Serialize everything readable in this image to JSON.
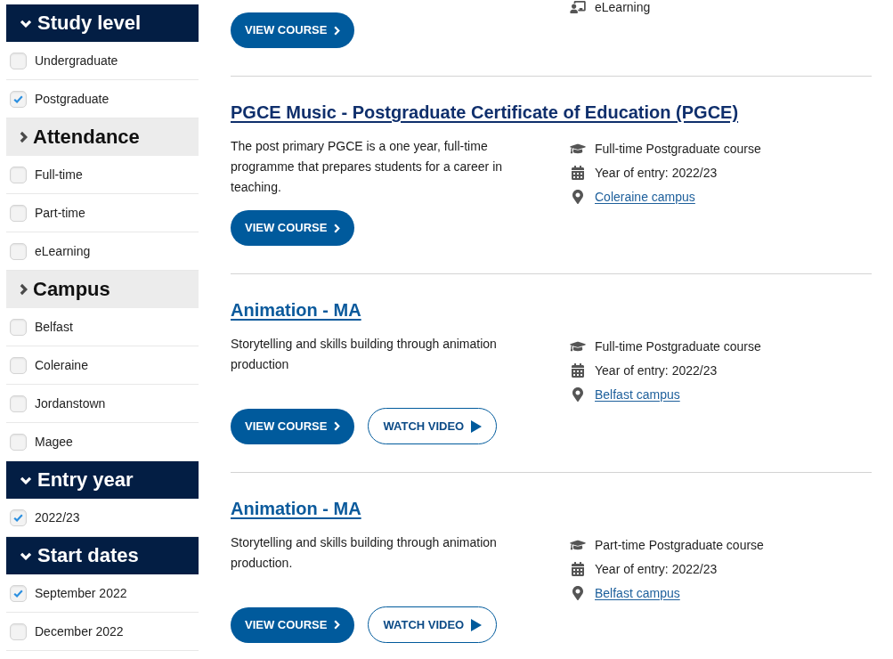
{
  "filters": [
    {
      "title": "Study level",
      "expanded": true,
      "options": [
        {
          "label": "Undergraduate",
          "checked": false
        },
        {
          "label": "Postgraduate",
          "checked": true
        }
      ]
    },
    {
      "title": "Attendance",
      "expanded": false,
      "options": [
        {
          "label": "Full-time",
          "checked": false
        },
        {
          "label": "Part-time",
          "checked": false
        },
        {
          "label": "eLearning",
          "checked": false
        }
      ]
    },
    {
      "title": "Campus",
      "expanded": false,
      "options": [
        {
          "label": "Belfast",
          "checked": false
        },
        {
          "label": "Coleraine",
          "checked": false
        },
        {
          "label": "Jordanstown",
          "checked": false
        },
        {
          "label": "Magee",
          "checked": false
        }
      ]
    },
    {
      "title": "Entry year",
      "expanded": true,
      "options": [
        {
          "label": "2022/23",
          "checked": true
        }
      ]
    },
    {
      "title": "Start dates",
      "expanded": true,
      "options": [
        {
          "label": "September 2022",
          "checked": true
        },
        {
          "label": "December 2022",
          "checked": false
        }
      ]
    }
  ],
  "results": [
    {
      "details": [
        {
          "kind": "delivery",
          "text": "eLearning"
        }
      ],
      "buttons": [
        {
          "kind": "view",
          "label": "VIEW COURSE"
        }
      ]
    },
    {
      "title": "PGCE Music - Postgraduate Certificate of Education (PGCE)",
      "visited": true,
      "description": "The post primary PGCE is a one year, full-time programme that prepares students for a career in teaching.",
      "details": [
        {
          "kind": "study",
          "text": "Full-time Postgraduate course"
        },
        {
          "kind": "year",
          "text": "Year of entry: 2022/23"
        },
        {
          "kind": "campus",
          "text": "Coleraine campus"
        }
      ],
      "buttons": [
        {
          "kind": "view",
          "label": "VIEW COURSE"
        }
      ]
    },
    {
      "title": "Animation - MA",
      "visited": false,
      "description": "Storytelling and skills building through animation production",
      "details": [
        {
          "kind": "study",
          "text": "Full-time Postgraduate course"
        },
        {
          "kind": "year",
          "text": "Year of entry: 2022/23"
        },
        {
          "kind": "campus",
          "text": "Belfast campus"
        }
      ],
      "buttons": [
        {
          "kind": "view",
          "label": "VIEW COURSE"
        },
        {
          "kind": "video",
          "label": "WATCH VIDEO"
        }
      ]
    },
    {
      "title": "Animation - MA",
      "visited": false,
      "description": "Storytelling and skills building through animation production.",
      "details": [
        {
          "kind": "study",
          "text": "Part-time Postgraduate course"
        },
        {
          "kind": "year",
          "text": "Year of entry: 2022/23"
        },
        {
          "kind": "campus",
          "text": "Belfast campus"
        }
      ],
      "buttons": [
        {
          "kind": "view",
          "label": "VIEW COURSE"
        },
        {
          "kind": "video",
          "label": "WATCH VIDEO"
        }
      ]
    }
  ]
}
